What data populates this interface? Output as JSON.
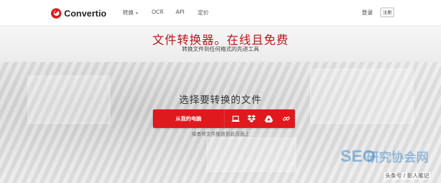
{
  "header": {
    "brand": "Convertio",
    "nav": {
      "convert": "转换",
      "ocr": "OCR",
      "api": "API",
      "pricing": "定价"
    },
    "login": "登录",
    "signup": "注册"
  },
  "hero": {
    "title": "文件转换器。在线且免费",
    "subtitle": "转换文件到任何格式的先进工具",
    "choose_files": "选择要转换的文件",
    "upload": {
      "from_computer": "从我的电脑",
      "icons": [
        "laptop-icon",
        "dropbox-icon",
        "google-drive-icon",
        "link-icon"
      ]
    },
    "drop_hint": "或者将文件拖放到此页面上"
  },
  "watermark": {
    "seo": "SEO",
    "cn": "研究协会网",
    "small": "头条号 / 影人笔记"
  },
  "colors": {
    "brand_red": "#e0191d",
    "title_red": "#c0151b"
  }
}
